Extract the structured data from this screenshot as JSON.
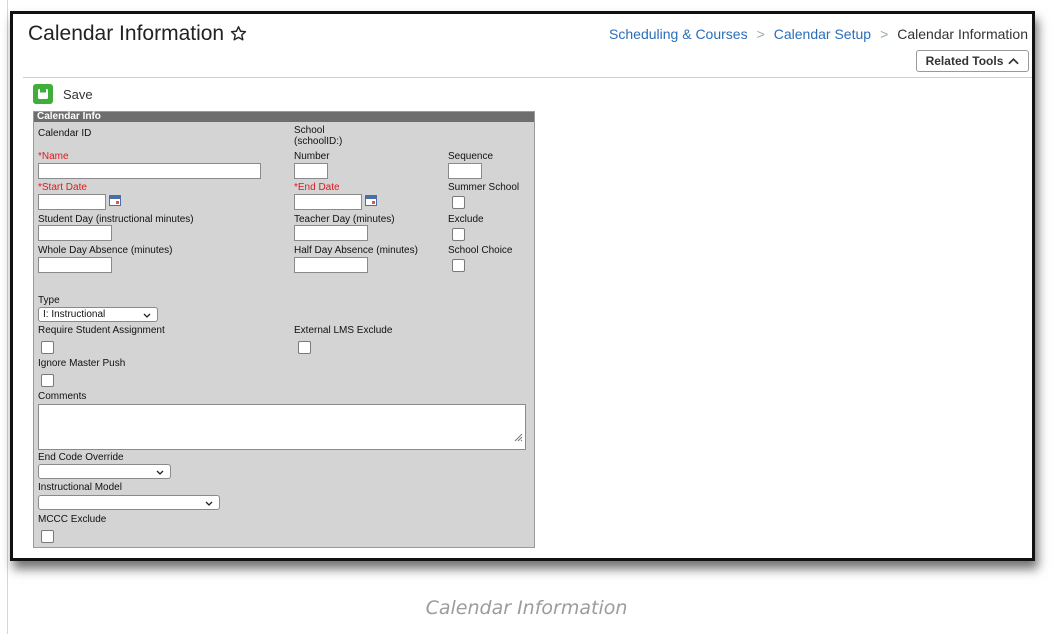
{
  "page": {
    "title": "Calendar Information",
    "breadcrumb": [
      "Scheduling & Courses",
      "Calendar Setup",
      "Calendar Information"
    ],
    "related_tools_label": "Related Tools",
    "caption": "Calendar Information"
  },
  "toolbar": {
    "save_label": "Save"
  },
  "panel": {
    "header": "Calendar Info",
    "labels": {
      "calendar_id": "Calendar ID",
      "school_1": "School",
      "school_2": "(schoolID:)",
      "name": "*Name",
      "number": "Number",
      "sequence": "Sequence",
      "start_date": "*Start Date",
      "end_date": "*End Date",
      "summer_school": "Summer School",
      "student_day": "Student Day (instructional minutes)",
      "teacher_day": "Teacher Day (minutes)",
      "exclude": "Exclude",
      "whole_day_absence": "Whole Day Absence (minutes)",
      "half_day_absence": "Half Day Absence (minutes)",
      "school_choice": "School Choice",
      "type": "Type",
      "require_student_assignment": "Require Student Assignment",
      "external_lms_exclude": "External LMS Exclude",
      "ignore_master_push": "Ignore Master Push",
      "comments": "Comments",
      "end_code_override": "End Code Override",
      "instructional_model": "Instructional Model",
      "mccc_exclude": "MCCC Exclude"
    },
    "values": {
      "type": "I: Instructional",
      "end_code_override": "",
      "instructional_model": ""
    }
  },
  "colors": {
    "link": "#2a6ebb",
    "required": "#e0191f",
    "save_green": "#3fae3b",
    "panel_header": "#6e6e6e",
    "panel_bg": "#d4d4d4"
  },
  "icons": [
    "star-icon",
    "chevron-up-icon",
    "save-icon",
    "calendar-icon",
    "chevron-down-icon",
    "resize-grip-icon"
  ]
}
